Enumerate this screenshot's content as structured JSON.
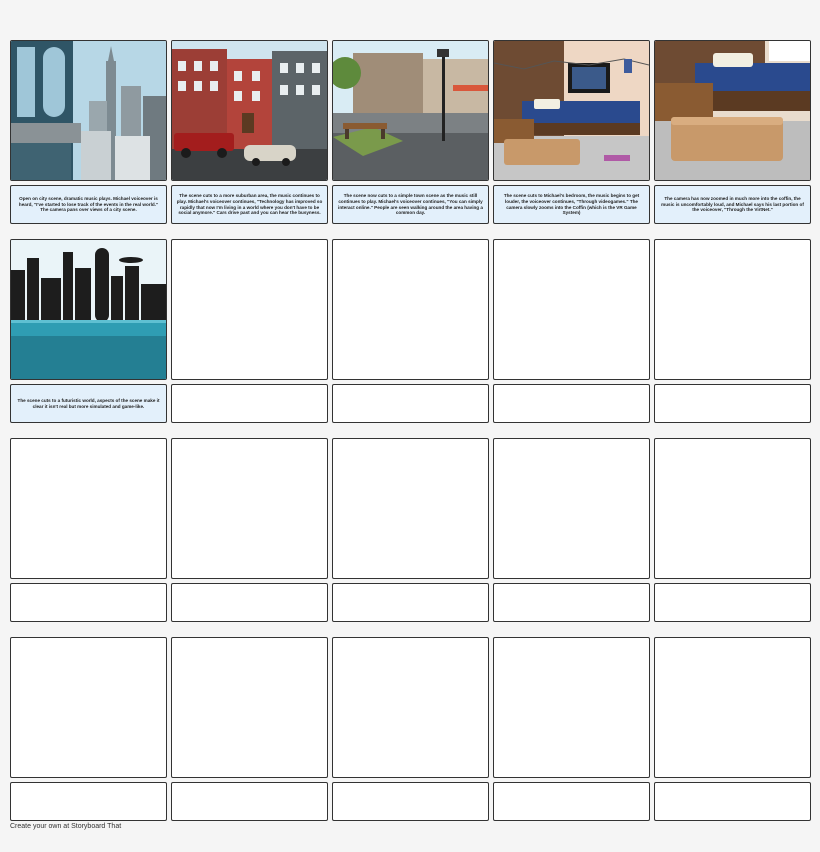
{
  "captions": [
    "Open on city scene, dramatic music plays. Michael voiceover is heard, \"I've started to lose track of the events in the real world.\" The camera pans over views of a city scene.",
    "The scene cuts to a more suburban area, the music continues to play. Michael's voiceover continues, \"Technology has improved so rapidly that now I'm living in a world where you don't have to be social anymore.\" Cars drive past and you can hear the busyness.",
    "The scene now cuts to a simple town scene as the music still continues to play. Michael's voiceover continues, \"You can simply interact online.\" People are seen walking around the area having a common day.",
    "The scene cuts to Michael's bedroom, the music begins to get louder, the voiceover continues, \"Through videogames.\" The camera slowly zooms into the Coffin (which is the VR Game System)",
    "The camera has now zoomed in much more into the coffin, the music is uncomfortably loud, and Michael says his last portion of the voiceover, \"Through the VirtNet.\"",
    "The scene cuts to a futuristic world, aspects of the scene make it clear it isn't real but more simulated and game-like."
  ],
  "footer": "Create your own at Storyboard That"
}
